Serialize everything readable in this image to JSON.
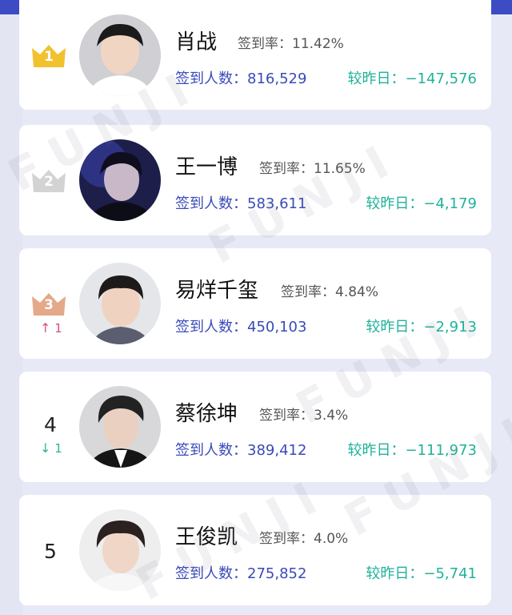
{
  "list": [
    {
      "rank_label": "1",
      "rank_style": "gold",
      "rank_change": "",
      "name": "肖战",
      "rate_label": "签到率：",
      "rate_value": "11.42%",
      "checkin_label": "签到人数：",
      "checkin_value": "816,529",
      "delta_label": "较昨日：",
      "delta_value": "−147,576"
    },
    {
      "rank_label": "2",
      "rank_style": "silver",
      "rank_change": "",
      "name": "王一博",
      "rate_label": "签到率：",
      "rate_value": "11.65%",
      "checkin_label": "签到人数：",
      "checkin_value": "583,611",
      "delta_label": "较昨日：",
      "delta_value": "−4,179"
    },
    {
      "rank_label": "3",
      "rank_style": "bronze",
      "rank_change_arrow": "↑",
      "rank_change": "1",
      "name": "易烊千玺",
      "rate_label": "签到率：",
      "rate_value": "4.84%",
      "checkin_label": "签到人数：",
      "checkin_value": "450,103",
      "delta_label": "较昨日：",
      "delta_value": "−2,913"
    },
    {
      "rank_label": "4",
      "rank_style": "plain",
      "rank_change_arrow": "↓",
      "rank_change": "1",
      "name": "蔡徐坤",
      "rate_label": "签到率：",
      "rate_value": "3.4%",
      "checkin_label": "签到人数：",
      "checkin_value": "389,412",
      "delta_label": "较昨日：",
      "delta_value": "−111,973"
    },
    {
      "rank_label": "5",
      "rank_style": "plain",
      "rank_change": "",
      "name": "王俊凯",
      "rate_label": "签到率：",
      "rate_value": "4.0%",
      "checkin_label": "签到人数：",
      "checkin_value": "275,852",
      "delta_label": "较昨日：",
      "delta_value": "−5,741"
    }
  ],
  "watermark": "FUNJI",
  "colors": {
    "header": "#3d4cc4",
    "gold": "#f2c12e",
    "silver": "#d3d3d3",
    "bronze": "#e3a989",
    "stat_blue": "#3a4ab9",
    "delta_green": "#1fb29a",
    "up_pink": "#d9507a"
  }
}
